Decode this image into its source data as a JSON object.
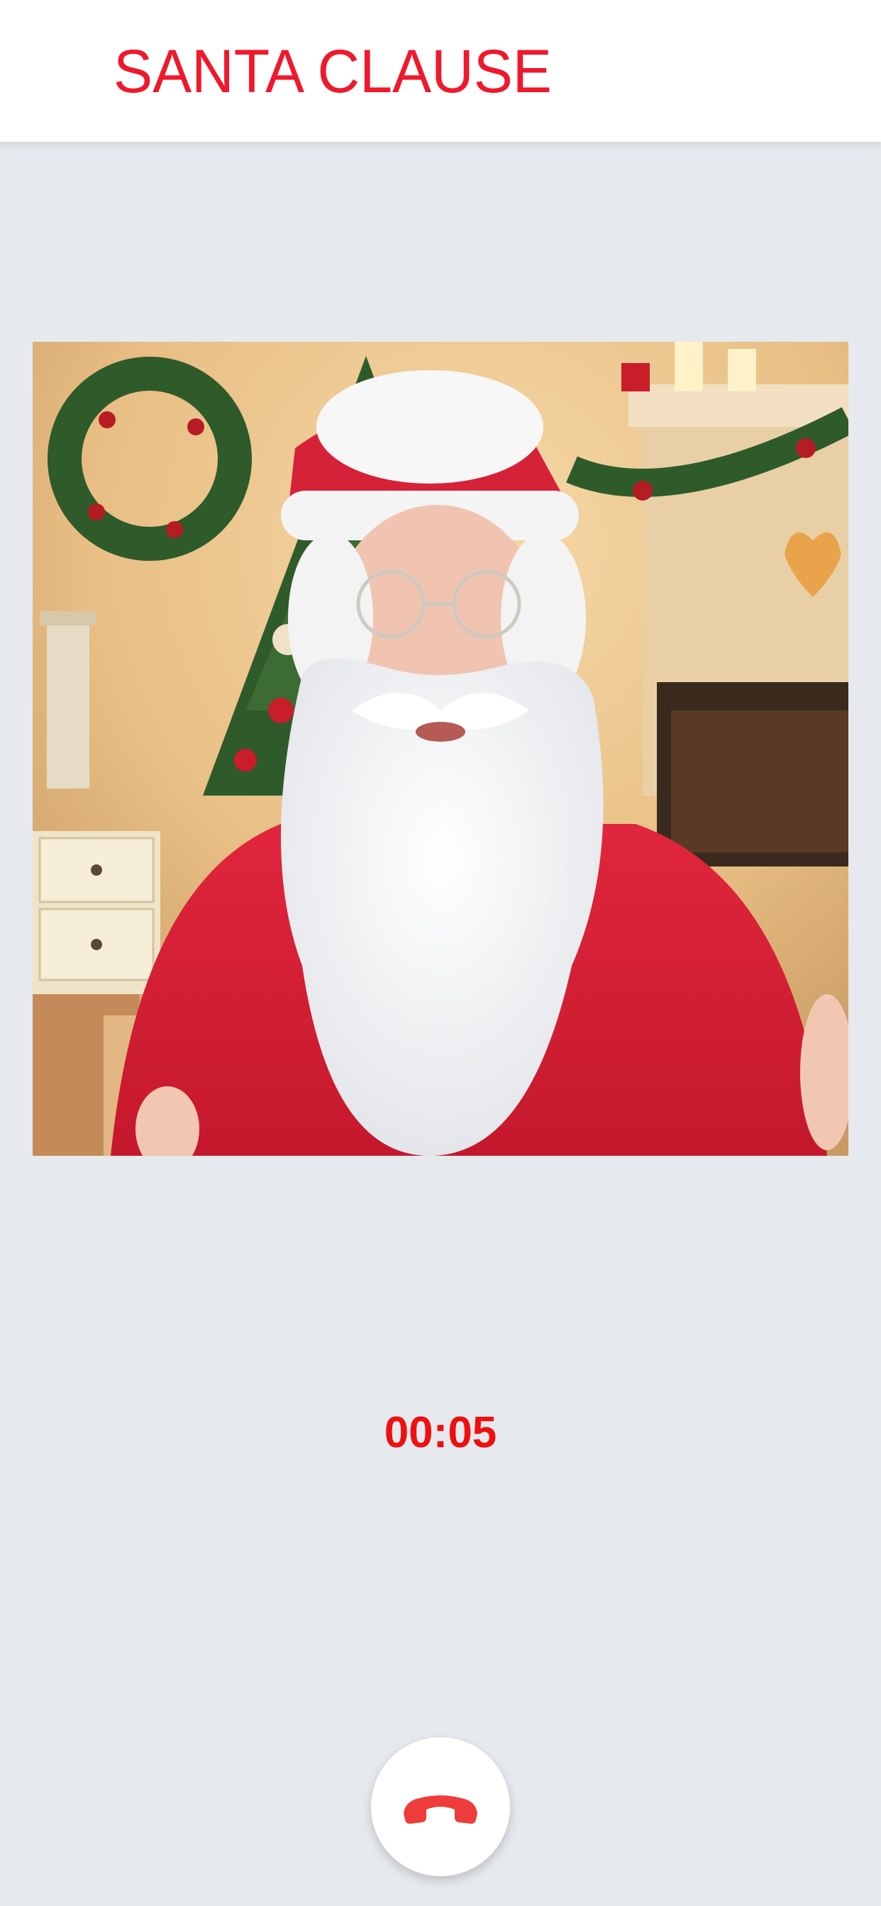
{
  "header": {
    "title": "SANTA CLAUSE"
  },
  "call": {
    "video_description_icon": "remote-video-feed",
    "timer": "00:05",
    "end_call_icon": "phone-hangup-icon"
  },
  "colors": {
    "accent": "#f0182c",
    "timer": "#ee1010",
    "background": "#e6e9ed",
    "header_bg": "#ffffff"
  }
}
